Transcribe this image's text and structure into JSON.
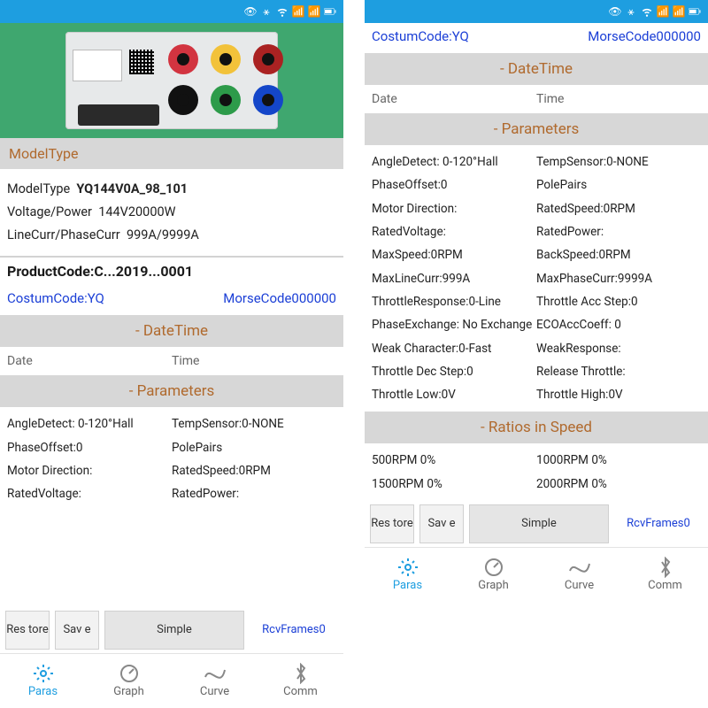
{
  "status": {
    "icons": [
      "eye",
      "bt",
      "wifi",
      "sig",
      "sig",
      "bat"
    ]
  },
  "left": {
    "section_model": "ModelType",
    "model_type_label": "ModelType",
    "model_type_value": "YQ144V0A_98_101",
    "voltage_label": "Voltage/Power",
    "voltage_value": "144V20000W",
    "curr_label": "LineCurr/PhaseCurr",
    "curr_value": "999A/9999A",
    "product_code": "ProductCode:C...2019...0001",
    "custom_code_label": "CostumCode:",
    "custom_code_value": "YQ",
    "morse_code": "MorseCode000000",
    "datetime_header": "- DateTime",
    "date_label": "Date",
    "time_label": "Time",
    "parameters_header": "- Parameters",
    "params": [
      [
        "AngleDetect: 0-120°Hall",
        "TempSensor:0-NONE"
      ],
      [
        "PhaseOffset:0",
        "PolePairs"
      ],
      [
        "Motor Direction:",
        "RatedSpeed:0RPM"
      ],
      [
        "RatedVoltage:",
        "RatedPower:"
      ]
    ]
  },
  "right": {
    "custom_code_label": "CostumCode:",
    "custom_code_value": "YQ",
    "morse_code": "MorseCode000000",
    "datetime_header": "- DateTime",
    "date_label": "Date",
    "time_label": "Time",
    "parameters_header": "- Parameters",
    "params": [
      [
        "AngleDetect: 0-120°Hall",
        "TempSensor:0-NONE"
      ],
      [
        "PhaseOffset:0",
        "PolePairs"
      ],
      [
        "Motor Direction:",
        "RatedSpeed:0RPM"
      ],
      [
        "RatedVoltage:",
        "RatedPower:"
      ],
      [
        "MaxSpeed:0RPM",
        "BackSpeed:0RPM"
      ],
      [
        "MaxLineCurr:999A",
        "MaxPhaseCurr:9999A"
      ],
      [
        "ThrottleResponse:0-Line",
        "Throttle Acc Step:0"
      ],
      [
        "PhaseExchange:  No Exchange",
        "ECOAccCoeff:  0"
      ],
      [
        "Weak Character:0-Fast",
        "WeakResponse:"
      ],
      [
        "Throttle Dec Step:0",
        "Release Throttle:"
      ],
      [
        "Throttle Low:0V",
        "Throttle High:0V"
      ]
    ],
    "ratios_header": "- Ratios in Speed",
    "ratios": [
      [
        "500RPM  0%",
        "1000RPM  0%"
      ],
      [
        "1500RPM  0%",
        "2000RPM  0%"
      ]
    ]
  },
  "actions": {
    "restore": "Res tore",
    "save": "Sav e",
    "simple": "Simple",
    "frames": "RcvFrames0"
  },
  "nav": {
    "paras": "Paras",
    "graph": "Graph",
    "curve": "Curve",
    "comm": "Comm"
  }
}
